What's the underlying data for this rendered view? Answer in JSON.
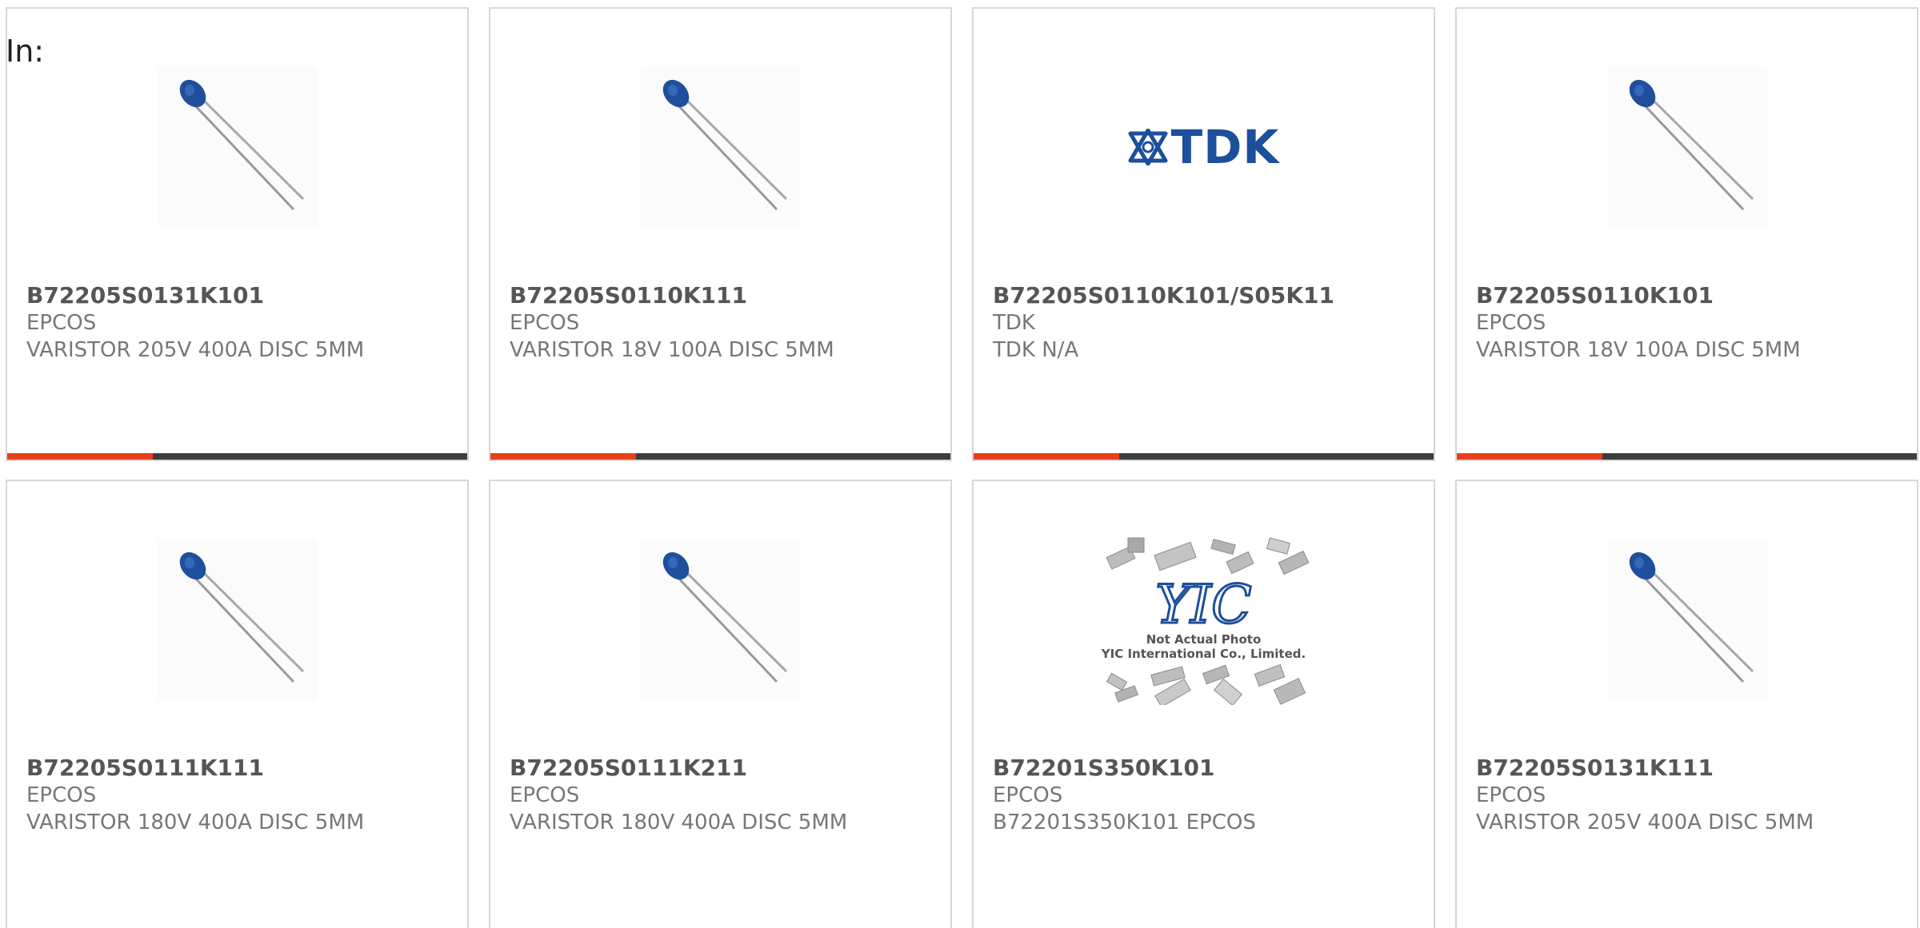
{
  "filter_label": "In:",
  "colors": {
    "accent": "#e8401c",
    "bar_dark": "#3d3d3d",
    "card_border": "#d7d7d7",
    "part_number": "#555555",
    "secondary_text": "#777777",
    "varistor_body": "#1f4f9c",
    "tdk_blue": "#1c4f9c"
  },
  "products": [
    {
      "part_number": "B72205S0131K101",
      "manufacturer": "EPCOS",
      "description": "VARISTOR 205V 400A DISC 5MM",
      "image": "varistor-photo",
      "show_bar": true
    },
    {
      "part_number": "B72205S0110K111",
      "manufacturer": "EPCOS",
      "description": "VARISTOR 18V 100A DISC 5MM",
      "image": "varistor-photo",
      "show_bar": true
    },
    {
      "part_number": "B72205S0110K101/S05K11",
      "manufacturer": "TDK",
      "description": "TDK N/A",
      "image": "tdk-logo",
      "logo_text": "TDK",
      "show_bar": true
    },
    {
      "part_number": "B72205S0110K101",
      "manufacturer": "EPCOS",
      "description": "VARISTOR 18V 100A DISC 5MM",
      "image": "varistor-photo",
      "show_bar": true
    },
    {
      "part_number": "B72205S0111K111",
      "manufacturer": "EPCOS",
      "description": "VARISTOR 180V 400A DISC 5MM",
      "image": "varistor-photo",
      "show_bar": false
    },
    {
      "part_number": "B72205S0111K211",
      "manufacturer": "EPCOS",
      "description": "VARISTOR 180V 400A DISC 5MM",
      "image": "varistor-photo",
      "show_bar": false
    },
    {
      "part_number": "B72201S350K101",
      "manufacturer": "EPCOS",
      "description": "B72201S350K101 EPCOS",
      "image": "yic-placeholder",
      "placeholder_logo": "YIC",
      "placeholder_line1": "Not Actual Photo",
      "placeholder_line2": "YIC International Co., Limited.",
      "show_bar": false
    },
    {
      "part_number": "B72205S0131K111",
      "manufacturer": "EPCOS",
      "description": "VARISTOR 205V 400A DISC 5MM",
      "image": "varistor-photo",
      "show_bar": false
    }
  ]
}
